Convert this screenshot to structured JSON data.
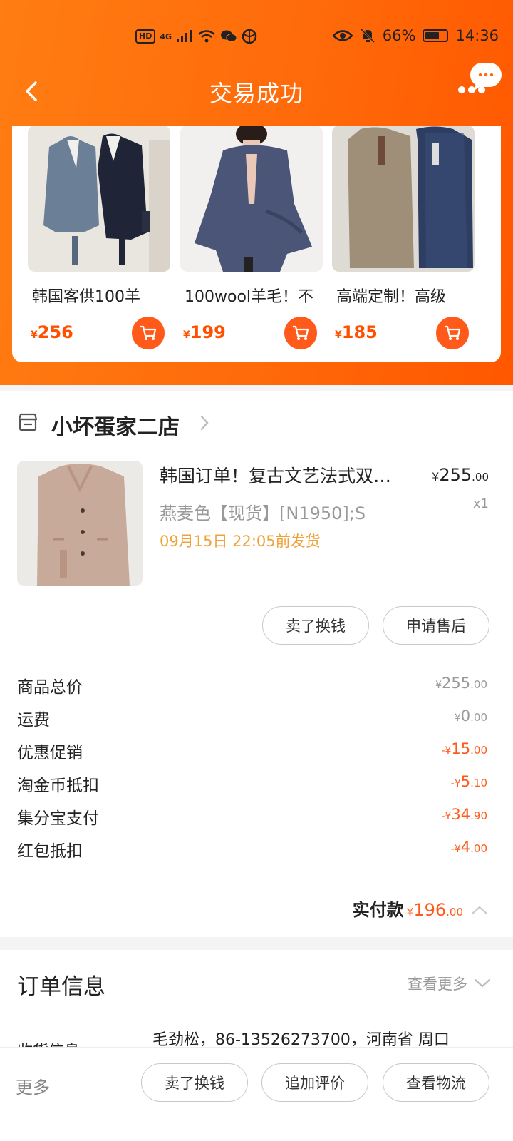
{
  "status_bar": {
    "hd": "HD",
    "net": "4G",
    "battery": "66%",
    "time": "14:36"
  },
  "nav": {
    "title": "交易成功"
  },
  "recommendations": [
    {
      "title": "韩国客供100羊",
      "price_yen": "¥",
      "price": "256"
    },
    {
      "title": "100wool羊毛！不",
      "price_yen": "¥",
      "price": "199"
    },
    {
      "title": "高端定制！高级",
      "price_yen": "¥",
      "price": "185"
    }
  ],
  "order": {
    "shop_name": "小坏蛋家二店",
    "product": {
      "title": "韩国订单！复古文艺法式双面羊毛大衣",
      "sku": "燕麦色【现货】[N1950];S",
      "ship_time": "09月15日 22:05前发货",
      "price_yen": "¥",
      "price_int": "255",
      "price_dec": ".00",
      "qty": "x1"
    },
    "actions": {
      "sell": "卖了换钱",
      "after_sale": "申请售后"
    },
    "fees": [
      {
        "label": "商品总价",
        "prefix": "¥",
        "int": "255",
        "dec": ".00",
        "highlight": false
      },
      {
        "label": "运费",
        "prefix": "¥",
        "int": "0",
        "dec": ".00",
        "highlight": false
      },
      {
        "label": "优惠促销",
        "prefix": "-¥",
        "int": "15",
        "dec": ".00",
        "highlight": true
      },
      {
        "label": "淘金币抵扣",
        "prefix": "-¥",
        "int": "5",
        "dec": ".10",
        "highlight": true
      },
      {
        "label": "集分宝支付",
        "prefix": "-¥",
        "int": "34",
        "dec": ".90",
        "highlight": true
      },
      {
        "label": "红包抵扣",
        "prefix": "-¥",
        "int": "4",
        "dec": ".00",
        "highlight": true
      }
    ],
    "total": {
      "label": "实付款",
      "yen": "¥",
      "int": "196",
      "dec": ".00"
    }
  },
  "order_info": {
    "title": "订单信息",
    "more": "查看更多",
    "receiver_label": "收货信息",
    "receiver": "毛劲松，86-13526273700，河南省 周口"
  },
  "bottom_bar": {
    "more": "更多",
    "sell": "卖了换钱",
    "review": "追加评价",
    "logistics": "查看物流"
  },
  "colors": {
    "brand_orange": "#ff6a0a",
    "price_orange": "#ff5a1a",
    "ship_time": "#f0a23a"
  }
}
